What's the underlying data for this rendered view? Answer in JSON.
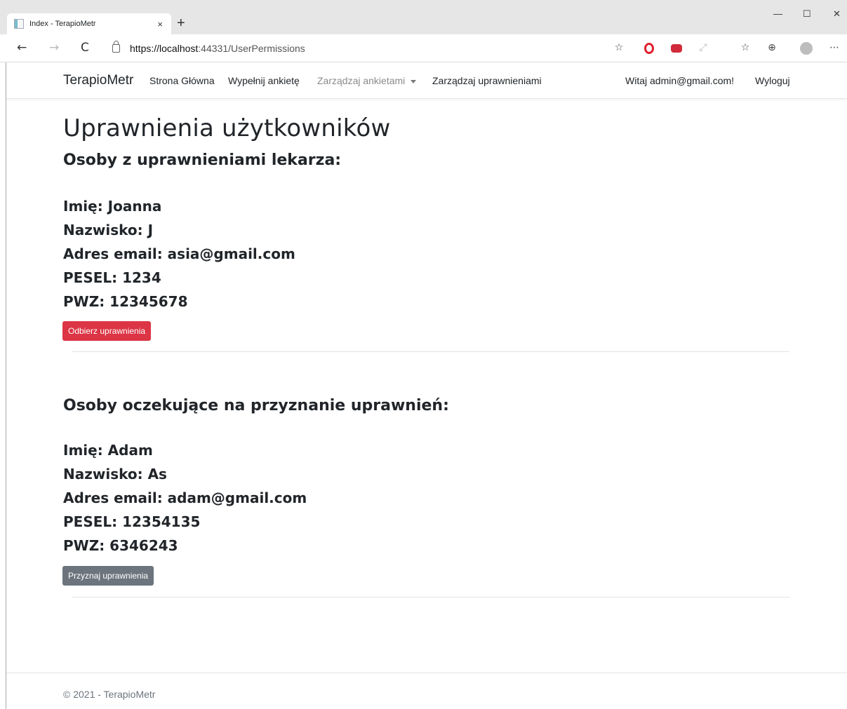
{
  "browser": {
    "tab_title": "Index - TerapioMetr",
    "tab_close": "×",
    "new_tab": "+",
    "url_host": "https://localhost",
    "url_rest": ":44331/UserPermissions",
    "window_controls": {
      "minimize": "—",
      "maximize": "☐",
      "close": "✕"
    },
    "nav": {
      "back": "←",
      "forward": "→",
      "reload": "C"
    }
  },
  "navbar": {
    "brand": "TerapioMetr",
    "links": [
      "Strona Główna",
      "Wypełnij ankietę",
      "Zarządzaj ankietami",
      "Zarządzaj uprawnieniami"
    ],
    "greeting": "Witaj admin@gmail.com!",
    "logout": "Wyloguj"
  },
  "page": {
    "title": "Uprawnienia użytkowników",
    "doctors_heading": "Osoby z uprawnieniami lekarza:",
    "doctor": {
      "first_name": "Imię: Joanna",
      "last_name": "Nazwisko: J",
      "email": "Adres email: asia@gmail.com",
      "pesel": "PESEL: 1234",
      "pwz": "PWZ: 12345678",
      "button": "Odbierz uprawnienia"
    },
    "pending_heading": "Osoby oczekujące na przyznanie uprawnień:",
    "pending": {
      "first_name": "Imię: Adam",
      "last_name": "Nazwisko: As",
      "email": "Adres email: adam@gmail.com",
      "pesel": "PESEL: 12354135",
      "pwz": "PWZ: 6346243",
      "button": "Przyznaj uprawnienia"
    }
  },
  "footer": {
    "text": "© 2021 - TerapioMetr"
  },
  "colors": {
    "danger": "#dc3545",
    "secondary": "#6c757d",
    "text": "#212529"
  }
}
